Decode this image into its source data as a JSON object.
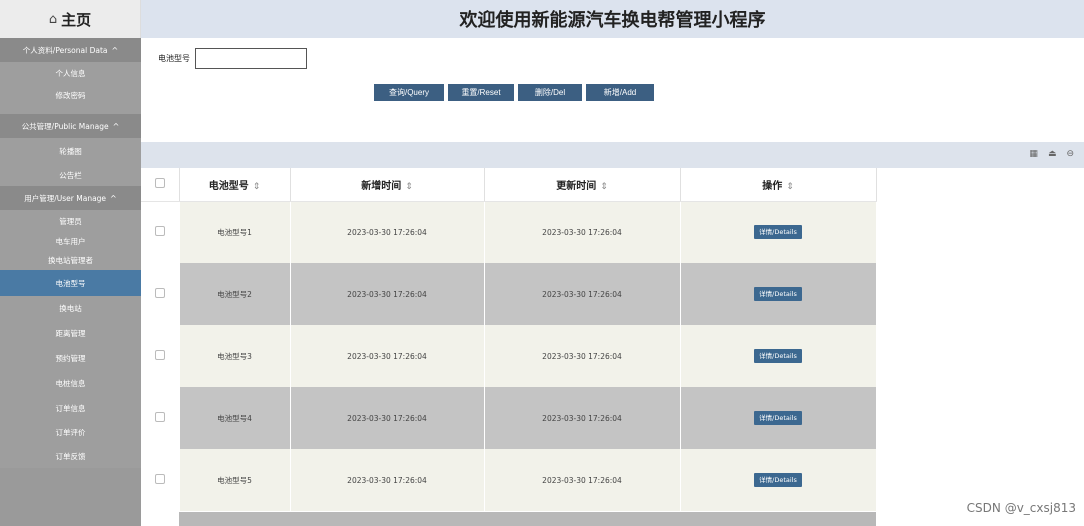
{
  "header": {
    "title": "欢迎使用新能源汽车换电帮管理小程序",
    "home_label": "主页"
  },
  "sidebar": {
    "sections": [
      {
        "label": "个人资料/Personal Data",
        "items": [
          "个人信息",
          "修改密码"
        ]
      },
      {
        "label": "公共管理/Public Manage",
        "items": [
          "轮播图",
          "公告栏"
        ]
      },
      {
        "label": "用户管理/User Manage",
        "items": [
          "管理员",
          "电车用户",
          "换电站管理者",
          "电池型号",
          "换电站",
          "距离管理",
          "预约管理",
          "电桩信息",
          "订单信息",
          "订单评价",
          "订单反馈"
        ]
      }
    ],
    "active": "电池型号"
  },
  "search": {
    "label": "电池型号",
    "value": ""
  },
  "buttons": {
    "query": "查询/Query",
    "reset": "重置/Reset",
    "delete": "删除/Del",
    "add": "新增/Add"
  },
  "table": {
    "headers": {
      "model": "电池型号",
      "created": "新增时间",
      "updated": "更新时间",
      "action": "操作"
    },
    "sort_icon": "⇕",
    "rows": [
      {
        "model": "电池型号1",
        "created": "2023-03-30 17:26:04",
        "updated": "2023-03-30 17:26:04",
        "action": "详情/Details"
      },
      {
        "model": "电池型号2",
        "created": "2023-03-30 17:26:04",
        "updated": "2023-03-30 17:26:04",
        "action": "详情/Details"
      },
      {
        "model": "电池型号3",
        "created": "2023-03-30 17:26:04",
        "updated": "2023-03-30 17:26:04",
        "action": "详情/Details"
      },
      {
        "model": "电池型号4",
        "created": "2023-03-30 17:26:04",
        "updated": "2023-03-30 17:26:04",
        "action": "详情/Details"
      },
      {
        "model": "电池型号5",
        "created": "2023-03-30 17:26:04",
        "updated": "2023-03-30 17:26:04",
        "action": "详情/Details"
      }
    ]
  },
  "toolbar_icons": [
    "columns-icon",
    "print-icon",
    "export-icon"
  ],
  "watermark": "CSDN @v_cxsj813",
  "colors": {
    "sidebar_bg": "#9a9a9a",
    "active_item": "#4a7aa4",
    "header_bg": "#dce3ee",
    "button_bg": "#3c5f82",
    "row_odd": "#f2f2ea",
    "row_even": "#c4c4c4"
  }
}
